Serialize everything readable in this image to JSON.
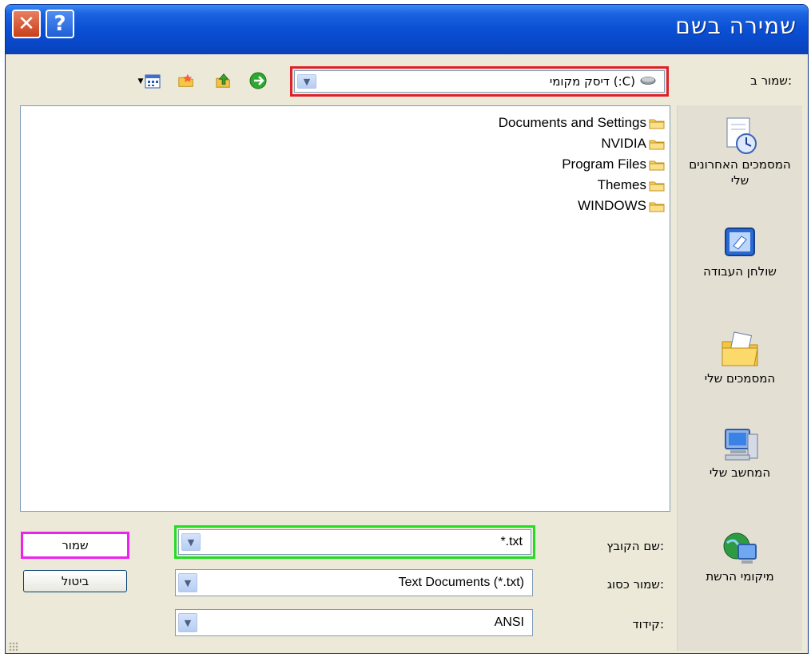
{
  "window": {
    "title": "שמירה בשם",
    "close_glyph": "✕",
    "help_glyph": "?"
  },
  "save_in": {
    "label": "שמור ב:",
    "value": "דיסק מקומי (:C)",
    "highlight_color": "#e0202a"
  },
  "files": [
    {
      "name": "Documents and Settings"
    },
    {
      "name": "NVIDIA"
    },
    {
      "name": "Program Files"
    },
    {
      "name": "Themes"
    },
    {
      "name": "WINDOWS"
    }
  ],
  "places": [
    {
      "label": "המסמכים האחרונים שלי",
      "icon": "recent-documents-icon"
    },
    {
      "label": "שולחן העבודה",
      "icon": "desktop-icon"
    },
    {
      "label": "המסמכים שלי",
      "icon": "my-documents-icon"
    },
    {
      "label": "המחשב שלי",
      "icon": "my-computer-icon"
    },
    {
      "label": "מיקומי הרשת",
      "icon": "network-places-icon"
    }
  ],
  "filename": {
    "label": "שם הקובץ:",
    "value": "*.txt",
    "highlight_color": "#22dd22"
  },
  "filetype": {
    "label": "שמור כסוג:",
    "value": "Text Documents (*.txt)"
  },
  "encoding": {
    "label": "קידוד:",
    "value": "ANSI"
  },
  "buttons": {
    "save": "שמור",
    "save_highlight_color": "#ee22ee",
    "cancel": "ביטול"
  },
  "colors": {
    "titlebar": "#0a4fd4",
    "dialog_bg": "#ece9d8"
  }
}
